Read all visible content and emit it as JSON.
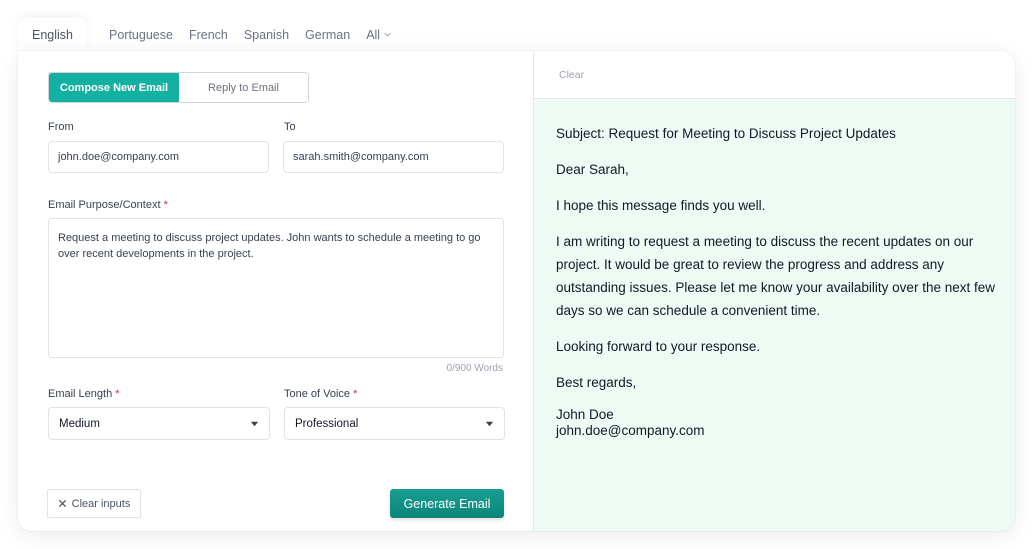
{
  "language_tabs": {
    "items": [
      "English",
      "Portuguese",
      "French",
      "Spanish",
      "German"
    ],
    "active": "English",
    "more_label": "All"
  },
  "mode": {
    "compose_label": "Compose New Email",
    "reply_label": "Reply to Email",
    "active": "compose"
  },
  "form": {
    "from_label": "From",
    "from_value": "john.doe@company.com",
    "to_label": "To",
    "to_value": "sarah.smith@company.com",
    "purpose_label": "Email Purpose/Context",
    "required_mark": "*",
    "purpose_value": "Request a meeting to discuss project updates. John wants to schedule a meeting to go over recent developments in the project.",
    "word_counter": "0/900 Words",
    "length_label": "Email Length",
    "length_value": "Medium",
    "tone_label": "Tone of Voice",
    "tone_value": "Professional",
    "clear_inputs_label": "Clear inputs",
    "generate_label": "Generate Email"
  },
  "output": {
    "clear_label": "Clear",
    "subject": "Subject: Request for Meeting to Discuss Project Updates",
    "greeting": "Dear Sarah,",
    "opening": "I hope this message finds you well.",
    "body": "I am writing to request a meeting to discuss the recent updates on our project. It would be great to review the progress and address any outstanding issues. Please let me know your availability over the next few days so we can schedule a convenient time.",
    "closing": "Looking forward to your response.",
    "signoff": "Best regards,",
    "sender_name": "John Doe",
    "sender_email": "john.doe@company.com"
  },
  "colors": {
    "accent": "#14b1a2",
    "generate_button": "#0f9184",
    "output_background": "#eefbf4"
  },
  "icons": {
    "all_chevron": "chevron-down-icon",
    "select_caret": "caret-down-icon",
    "clear": "close-icon"
  }
}
